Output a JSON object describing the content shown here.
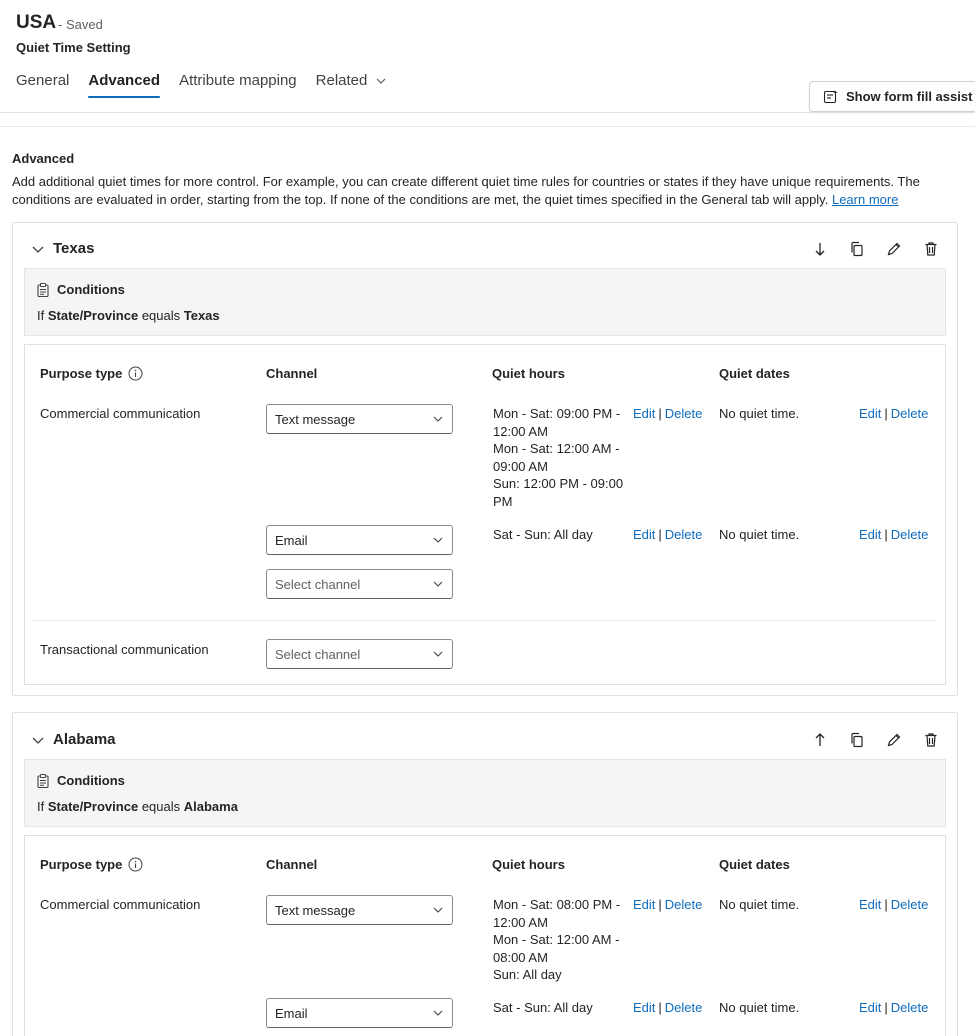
{
  "header": {
    "title": "USA",
    "saved": "- Saved",
    "subtitle": "Quiet Time Setting",
    "tabs": [
      "General",
      "Advanced",
      "Attribute mapping",
      "Related"
    ],
    "fill_assist": "Show form fill assist"
  },
  "section": {
    "title": "Advanced",
    "desc_line1": "Add additional quiet times for more control. For example, you can create different quiet time rules for countries or states if they have unique requirements. The",
    "desc_line2": "conditions are evaluated in order, starting from the top. If none of the conditions are met, the quiet times specified in the General tab will apply.",
    "learn_more": "Learn more"
  },
  "columns": {
    "purpose": "Purpose type",
    "channel": "Channel",
    "quiet_hours": "Quiet hours",
    "quiet_dates": "Quiet dates"
  },
  "common": {
    "conditions": "Conditions",
    "if": "If",
    "field": "State/Province",
    "op": "equals",
    "edit": "Edit",
    "delete": "Delete",
    "pipe": "|",
    "select_channel": "Select channel",
    "no_quiet": "No quiet time."
  },
  "cards": [
    {
      "name": "Texas",
      "value": "Texas",
      "rows": [
        {
          "purpose": "Commercial communication",
          "channel1": "Text message",
          "hours1": [
            "Mon - Sat: 09:00 PM -",
            "12:00 AM",
            "Mon - Sat: 12:00 AM -",
            "09:00 AM",
            "Sun: 12:00 PM - 09:00",
            "PM"
          ],
          "channel2": "Email",
          "hours2": [
            "Sat - Sun: All day"
          ]
        },
        {
          "purpose": "Transactional communication"
        }
      ]
    },
    {
      "name": "Alabama",
      "value": "Alabama",
      "rows": [
        {
          "purpose": "Commercial communication",
          "channel1": "Text message",
          "hours1": [
            "Mon - Sat: 08:00 PM -",
            "12:00 AM",
            "Mon - Sat: 12:00 AM -",
            "08:00 AM",
            "Sun: All day"
          ],
          "channel2": "Email",
          "hours2": [
            "Sat - Sun: All day"
          ]
        }
      ]
    }
  ]
}
